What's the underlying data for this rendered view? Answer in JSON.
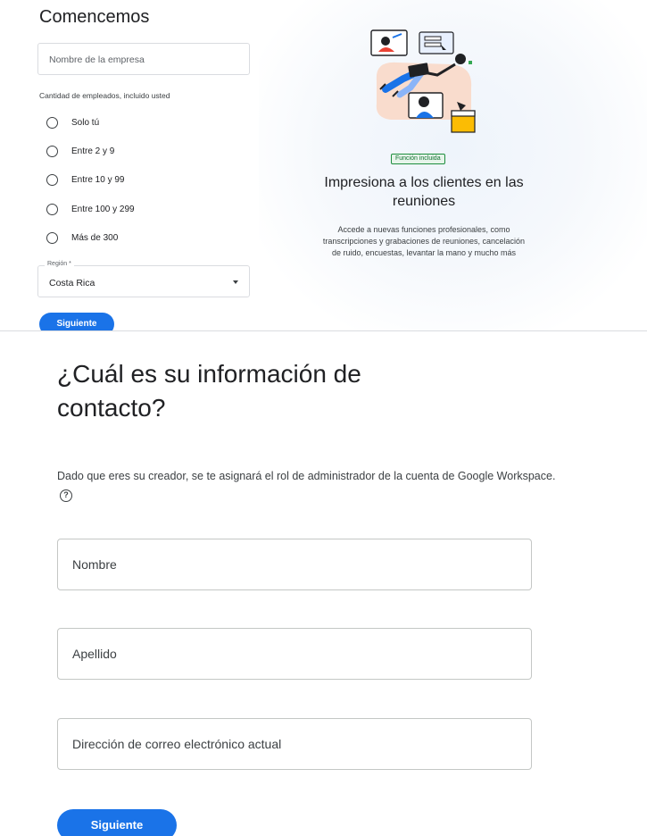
{
  "top": {
    "title": "Comencemos",
    "company_placeholder": "Nombre de la empresa",
    "employees_label": "Cantidad de empleados, incluido usted",
    "employee_options": [
      "Solo tú",
      "Entre 2 y 9",
      "Entre 10 y 99",
      "Entre 100 y 299",
      "Más de 300"
    ],
    "region_label": "Región *",
    "region_value": "Costa Rica",
    "next_label": "Siguiente"
  },
  "promo": {
    "badge": "Función incluida",
    "title": "Impresiona a los clientes en las reuniones",
    "body": "Accede a nuevas funciones profesionales, como transcripciones y grabaciones de reuniones, cancelación de ruido, encuestas, levantar la mano y mucho más"
  },
  "contact": {
    "title": "¿Cuál es su información de contacto?",
    "description": "Dado que eres su creador, se te asignará el rol de administrador de la cuenta de Google Workspace.",
    "help_icon": "help-circle-icon",
    "first_name_placeholder": "Nombre",
    "last_name_placeholder": "Apellido",
    "email_placeholder": "Dirección de correo electrónico actual",
    "next_label": "Siguiente"
  },
  "colors": {
    "primary": "#1a73e8",
    "badge_green": "#137333"
  }
}
